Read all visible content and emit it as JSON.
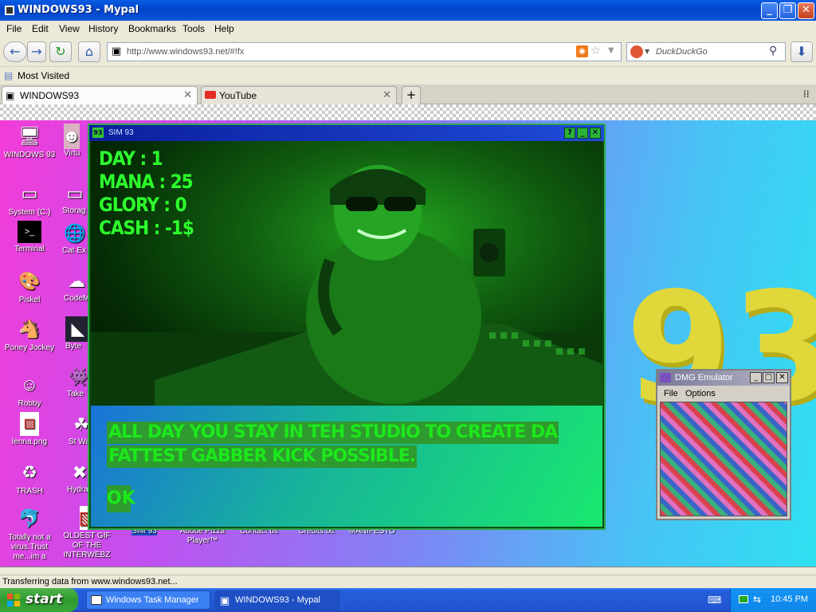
{
  "window": {
    "title": "WINDOWS93 - Mypal"
  },
  "menu": [
    "File",
    "Edit",
    "View",
    "History",
    "Bookmarks",
    "Tools",
    "Help"
  ],
  "nav": {
    "url": "http://www.windows93.net/#!fx",
    "search_placeholder": "DuckDuckGo"
  },
  "bookmarks": {
    "most_visited": "Most Visited"
  },
  "tabs": [
    {
      "label": "WINDOWS93",
      "active": true
    },
    {
      "label": "YouTube",
      "active": false
    }
  ],
  "desktop": {
    "icons_col1": [
      "WINDOWS 93",
      "System (C:)",
      "Terminal",
      "Piskel",
      "Poney Jockey",
      "Robby",
      "lenna.png",
      "TRASH",
      "Totally not a virus.Trust me...im a"
    ],
    "icons_col2": [
      "Virtu",
      "Storag",
      "Cat Ex",
      "CodeM",
      "Byte",
      "Take",
      "St Wars",
      "Hydra",
      "OLDEST GIF OF THE INTERWEBZ"
    ],
    "icons_row": [
      "SIM 93",
      "Adobe Pizza Player™",
      "Contact us",
      "Credits.txt",
      "MANIFESTO"
    ],
    "bigmark": "93"
  },
  "sim": {
    "title": "SIM 93",
    "stats": {
      "day": "DAY : 1",
      "mana": "MANA : 25",
      "glory": "GLORY : 0",
      "cash": "CASH : -1$"
    },
    "story_line1": "ALL DAY YOU STAY IN TEH STUDIO TO CREATE DA",
    "story_line2": "FATTEST GABBER KICK POSSIBLE.",
    "ok": "OK"
  },
  "dmg": {
    "title": "DMG Emulator",
    "menu_file": "File",
    "menu_options": "Options"
  },
  "status": {
    "text": "Transferring data from www.windows93.net..."
  },
  "taskbar": {
    "start": "start",
    "buttons": [
      {
        "label": "Windows Task Manager",
        "active": false
      },
      {
        "label": "WINDOWS93 - Mypal",
        "active": true
      }
    ],
    "clock": "10:45 PM"
  }
}
